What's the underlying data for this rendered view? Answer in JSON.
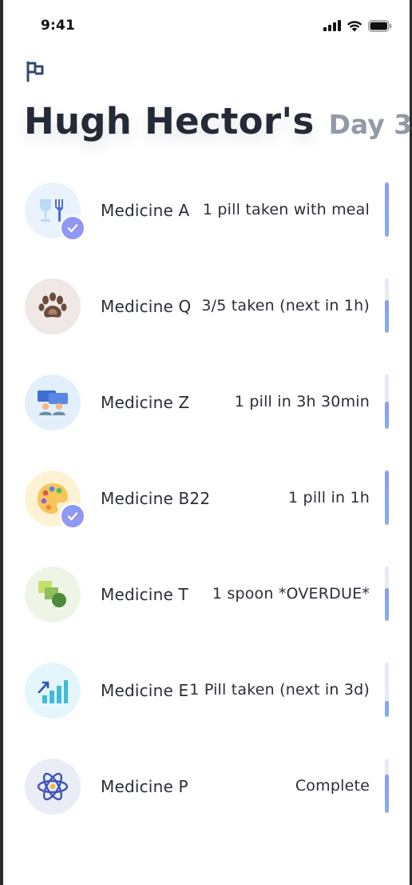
{
  "status_bar": {
    "time": "9:41",
    "icons": [
      "cellular-signal-icon",
      "wifi-icon",
      "battery-icon"
    ]
  },
  "header": {
    "flag_icon": "flag-icon",
    "title": "Hugh Hector's",
    "day": "Day 3"
  },
  "colors": {
    "accent": "#8f98f5",
    "progress_fill": "#85a6f1",
    "progress_track": "#e6e9f6",
    "title": "#242a36",
    "day": "#9299a8"
  },
  "medicines": [
    {
      "name": "Medicine A",
      "status": "1 pill taken with meal",
      "icon": "glass-fork-icon",
      "avatar_bg": "#eaf3fd",
      "checked": true,
      "progress": 1.0
    },
    {
      "name": "Medicine Q",
      "status": "3/5 taken (next in 1h)",
      "icon": "paw-icon",
      "avatar_bg": "#efe8e6",
      "checked": false,
      "progress": 0.6
    },
    {
      "name": "Medicine Z",
      "status": "1 pill in 3h 30min",
      "icon": "people-icon",
      "avatar_bg": "#e3f0fc",
      "checked": false,
      "progress": 0.5
    },
    {
      "name": "Medicine B22",
      "status": "1 pill in 1h",
      "icon": "palette-icon",
      "avatar_bg": "#fdf2d3",
      "checked": true,
      "progress": 1.0
    },
    {
      "name": "Medicine T",
      "status": "1 spoon *OVERDUE*",
      "icon": "shapes-icon",
      "avatar_bg": "#eef5e6",
      "checked": false,
      "progress": 0.6
    },
    {
      "name": "Medicine E",
      "status": "1 Pill taken (next in 3d)",
      "icon": "bar-chart-icon",
      "avatar_bg": "#e4f6fb",
      "checked": false,
      "progress": 0.3
    },
    {
      "name": "Medicine P",
      "status": "Complete",
      "icon": "atom-icon",
      "avatar_bg": "#ebedf6",
      "checked": false,
      "progress": 0.7
    }
  ]
}
